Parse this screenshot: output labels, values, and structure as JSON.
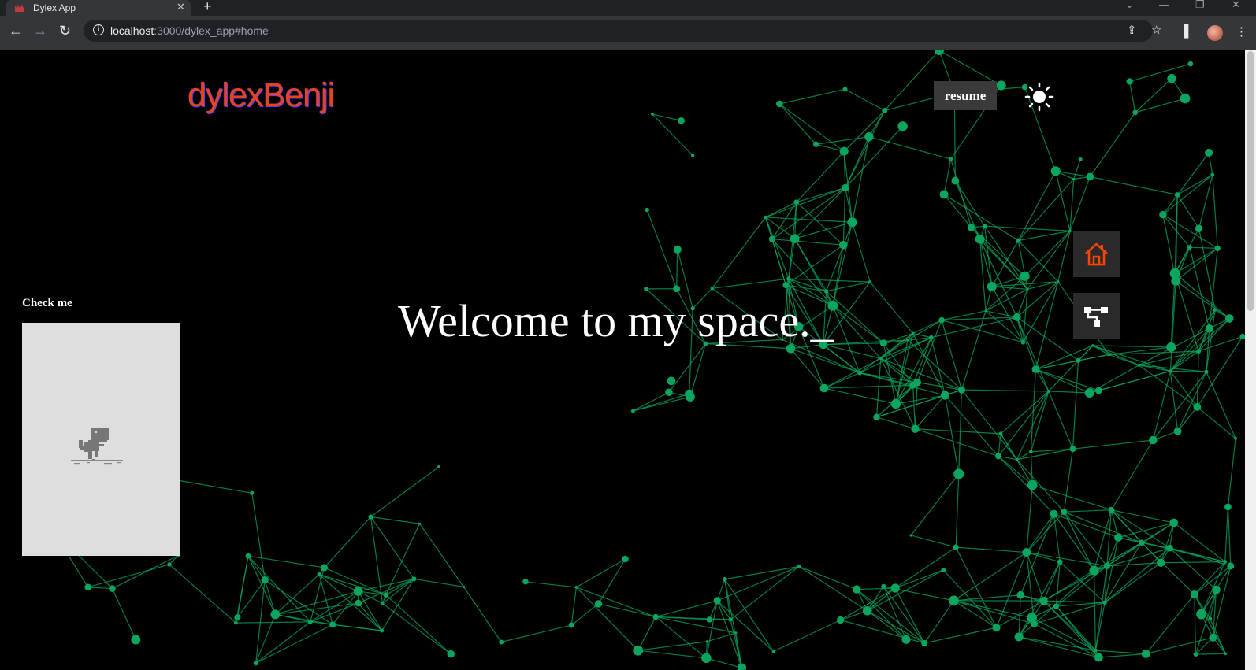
{
  "browser": {
    "tab_title": "Dylex App",
    "new_tab_label": "+",
    "url_host": "localhost",
    "url_path": ":3000/dylex_app#home"
  },
  "header": {
    "logo_text": "dylexBenji",
    "resume_label": "resume",
    "theme_icon": "sun-icon"
  },
  "side_nav": [
    {
      "name": "home",
      "icon": "home-icon",
      "color": "#ff4500"
    },
    {
      "name": "projects",
      "icon": "sitemap-icon",
      "color": "#ffffff"
    }
  ],
  "hero": {
    "welcome_text": "Welcome to my space._"
  },
  "game_widget": {
    "label": "Check me",
    "icon": "dino-icon"
  },
  "colors": {
    "background": "#000000",
    "network": "#0aa55e",
    "logo": "#e8431f",
    "accent": "#ff4500"
  }
}
